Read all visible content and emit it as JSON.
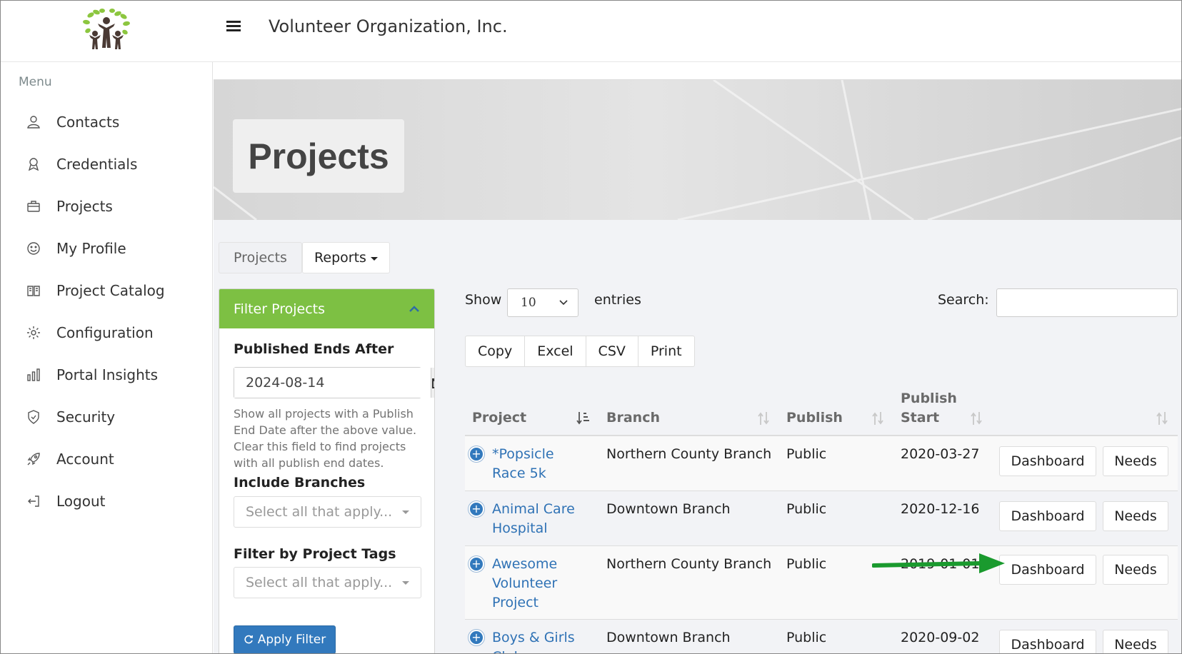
{
  "header": {
    "app_title": "Volunteer Organization, Inc."
  },
  "sidebar": {
    "heading": "Menu",
    "items": [
      {
        "label": "Contacts",
        "icon": "contacts-icon"
      },
      {
        "label": "Credentials",
        "icon": "award-icon"
      },
      {
        "label": "Projects",
        "icon": "briefcase-icon"
      },
      {
        "label": "My Profile",
        "icon": "smiley-icon"
      },
      {
        "label": "Project Catalog",
        "icon": "book-icon"
      },
      {
        "label": "Configuration",
        "icon": "gear-icon"
      },
      {
        "label": "Portal Insights",
        "icon": "bar-chart-icon"
      },
      {
        "label": "Security",
        "icon": "shield-icon"
      },
      {
        "label": "Account",
        "icon": "rocket-icon"
      },
      {
        "label": "Logout",
        "icon": "logout-icon"
      }
    ]
  },
  "page": {
    "title": "Projects",
    "tabs": {
      "projects": "Projects",
      "reports": "Reports"
    }
  },
  "filter": {
    "title": "Filter Projects",
    "published_ends_after_label": "Published Ends After",
    "published_ends_after_value": "2024-08-14",
    "help_text": "Show all projects with a Publish End Date after the above value. Clear this field to find projects with all publish end dates.",
    "include_branches_label": "Include Branches",
    "include_branches_placeholder": "Select all that apply...",
    "project_tags_label": "Filter by Project Tags",
    "project_tags_placeholder": "Select all that apply...",
    "apply_label": "Apply Filter"
  },
  "table_controls": {
    "show_label": "Show",
    "entries_value": "10",
    "entries_label": "entries",
    "search_label": "Search:",
    "search_value": "",
    "export_buttons": [
      "Copy",
      "Excel",
      "CSV",
      "Print"
    ]
  },
  "table": {
    "headers": {
      "project": "Project",
      "branch": "Branch",
      "publish": "Publish",
      "publish_start": "Publish Start"
    },
    "rows": [
      {
        "project": "*Popsicle Race 5k",
        "branch": "Northern County Branch",
        "publish": "Public",
        "start": "2020-03-27",
        "dashboard": "Dashboard",
        "needs": "Needs"
      },
      {
        "project": "Animal Care Hospital",
        "branch": "Downtown Branch",
        "publish": "Public",
        "start": "2020-12-16",
        "dashboard": "Dashboard",
        "needs": "Needs"
      },
      {
        "project": "Awesome Volunteer Project",
        "branch": "Northern County Branch",
        "publish": "Public",
        "start": "2019-01-01",
        "dashboard": "Dashboard",
        "needs": "Needs"
      },
      {
        "project": "Boys & Girls Club",
        "branch": "Downtown Branch",
        "publish": "Public",
        "start": "2020-09-02",
        "dashboard": "Dashboard",
        "needs": "Needs"
      }
    ]
  },
  "colors": {
    "filter_header": "#7dc043",
    "link": "#2f72b5",
    "primary_button": "#3279bd",
    "annotation_arrow": "#1a9a2e"
  }
}
